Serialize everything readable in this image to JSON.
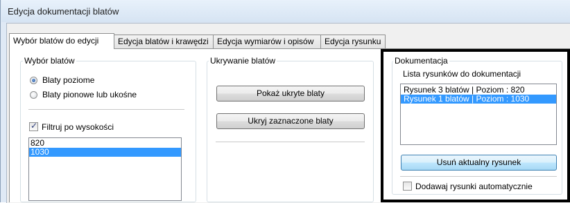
{
  "window": {
    "title": "Edycja dokumentacji blatów"
  },
  "tabs": [
    {
      "label": "Wybór blatów do edycji",
      "active": true
    },
    {
      "label": "Edycja blatów i krawędzi",
      "active": false
    },
    {
      "label": "Edycja wymiarów i opisów",
      "active": false
    },
    {
      "label": "Edycja rysunku",
      "active": false
    }
  ],
  "selection_group": {
    "title": "Wybór blatów",
    "radio_horizontal": {
      "label": "Blaty poziome",
      "checked": true
    },
    "radio_vertical": {
      "label": "Blaty pionowe lub ukośne",
      "checked": false
    },
    "filter_checkbox": {
      "label": "Filtruj po wysokości",
      "checked": true
    },
    "heights": [
      {
        "value": "820",
        "selected": false
      },
      {
        "value": "1030",
        "selected": true
      }
    ]
  },
  "hiding_group": {
    "title": "Ukrywanie blatów",
    "show_hidden_button": "Pokaż ukryte blaty",
    "hide_selected_button": "Ukryj zaznaczone blaty"
  },
  "documentation_group": {
    "title": "Dokumentacja",
    "list_label": "Lista rysunków do dokumentacji",
    "drawings": [
      {
        "label": "Rysunek 3 blatów  |  Poziom : 820",
        "selected": false
      },
      {
        "label": "Rysunek 1 blatów  |  Poziom : 1030",
        "selected": true
      }
    ],
    "remove_button": "Usuń aktualny rysunek",
    "auto_add_checkbox": {
      "label": "Dodawaj rysunki automatycznie",
      "checked": false
    }
  },
  "colors": {
    "selection": "#3399ff",
    "title_bar": "#dfe9f5",
    "highlight_border": "#000000"
  }
}
